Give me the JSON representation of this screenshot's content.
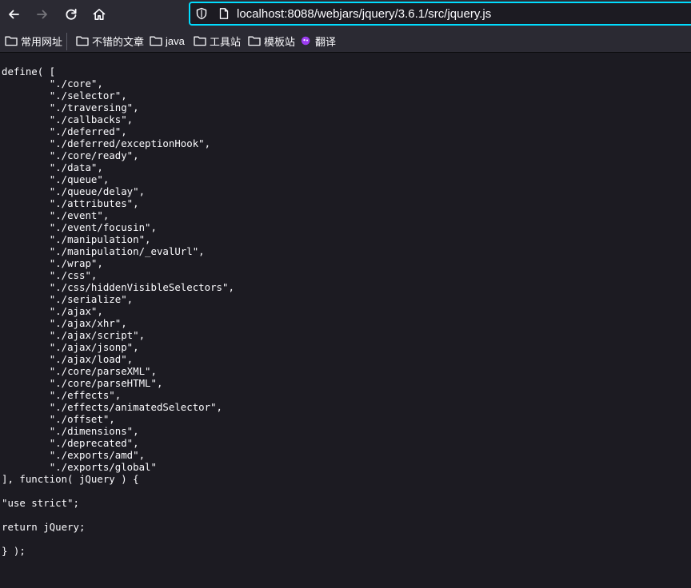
{
  "browser": {
    "url": "localhost:8088/webjars/jquery/3.6.1/src/jquery.js",
    "icons": [
      "back-arrow-icon",
      "forward-arrow-icon",
      "reload-icon",
      "home-icon",
      "shield-icon",
      "page-icon",
      "folder-icon",
      "translate-icon"
    ],
    "accent_color": "#00ddff"
  },
  "bookmarks": [
    {
      "label": "常用网址",
      "icon": "folder-icon"
    },
    {
      "label": "不错的文章",
      "icon": "folder-icon"
    },
    {
      "label": "java",
      "icon": "folder-icon"
    },
    {
      "label": "工具站",
      "icon": "folder-icon"
    },
    {
      "label": "模板站",
      "icon": "folder-icon"
    },
    {
      "label": "翻译",
      "icon": "translate-icon"
    }
  ],
  "source_code": "define( [\n\t\"./core\",\n\t\"./selector\",\n\t\"./traversing\",\n\t\"./callbacks\",\n\t\"./deferred\",\n\t\"./deferred/exceptionHook\",\n\t\"./core/ready\",\n\t\"./data\",\n\t\"./queue\",\n\t\"./queue/delay\",\n\t\"./attributes\",\n\t\"./event\",\n\t\"./event/focusin\",\n\t\"./manipulation\",\n\t\"./manipulation/_evalUrl\",\n\t\"./wrap\",\n\t\"./css\",\n\t\"./css/hiddenVisibleSelectors\",\n\t\"./serialize\",\n\t\"./ajax\",\n\t\"./ajax/xhr\",\n\t\"./ajax/script\",\n\t\"./ajax/jsonp\",\n\t\"./ajax/load\",\n\t\"./core/parseXML\",\n\t\"./core/parseHTML\",\n\t\"./effects\",\n\t\"./effects/animatedSelector\",\n\t\"./offset\",\n\t\"./dimensions\",\n\t\"./deprecated\",\n\t\"./exports/amd\",\n\t\"./exports/global\"\n], function( jQuery ) {\n\n\"use strict\";\n\nreturn jQuery;\n\n} );"
}
